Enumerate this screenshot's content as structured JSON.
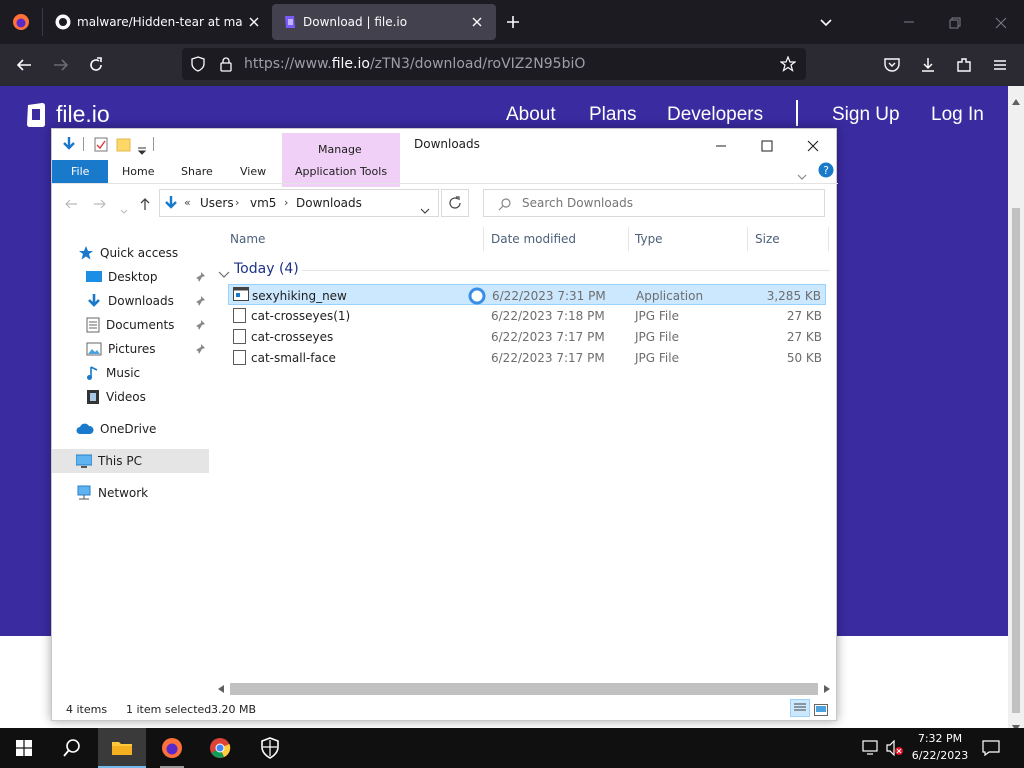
{
  "browser": {
    "tabs": [
      {
        "title": "malware/Hidden-tear at master"
      },
      {
        "title": "Download | file.io"
      }
    ],
    "url_prefix": "https://www.",
    "url_host": "file.io",
    "url_path": "/zTN3/download/roVIZ2N95biO"
  },
  "site": {
    "logo_text": "file.io",
    "nav": [
      "About",
      "Plans",
      "Developers",
      "Sign Up",
      "Log In"
    ]
  },
  "explorer": {
    "title": "Downloads",
    "manage_label": "Manage",
    "ribbon_tabs": [
      "File",
      "Home",
      "Share",
      "View",
      "Application Tools"
    ],
    "breadcrumb": [
      "Users",
      "vm5",
      "Downloads"
    ],
    "search_placeholder": "Search Downloads",
    "columns": {
      "name": "Name",
      "date": "Date modified",
      "type": "Type",
      "size": "Size"
    },
    "group_label": "Today (4)",
    "files": [
      {
        "name": "sexyhiking_new",
        "date": "6/22/2023 7:31 PM",
        "type": "Application",
        "size": "3,285 KB"
      },
      {
        "name": "cat-crosseyes(1)",
        "date": "6/22/2023 7:18 PM",
        "type": "JPG File",
        "size": "27 KB"
      },
      {
        "name": "cat-crosseyes",
        "date": "6/22/2023 7:17 PM",
        "type": "JPG File",
        "size": "27 KB"
      },
      {
        "name": "cat-small-face",
        "date": "6/22/2023 7:17 PM",
        "type": "JPG File",
        "size": "50 KB"
      }
    ],
    "nav_pane": {
      "quick_access": "Quick access",
      "desktop": "Desktop",
      "downloads": "Downloads",
      "documents": "Documents",
      "pictures": "Pictures",
      "music": "Music",
      "videos": "Videos",
      "onedrive": "OneDrive",
      "this_pc": "This PC",
      "network": "Network"
    },
    "status": {
      "items": "4 items",
      "selected": "1 item selected",
      "size": "3.20 MB"
    }
  },
  "taskbar": {
    "time": "7:32 PM",
    "date": "6/22/2023"
  },
  "colors": {
    "site_header": "#3a2ba0",
    "accent": "#1979ca",
    "manage_tab": "#f0d0f6",
    "selection": "#cce8ff"
  }
}
